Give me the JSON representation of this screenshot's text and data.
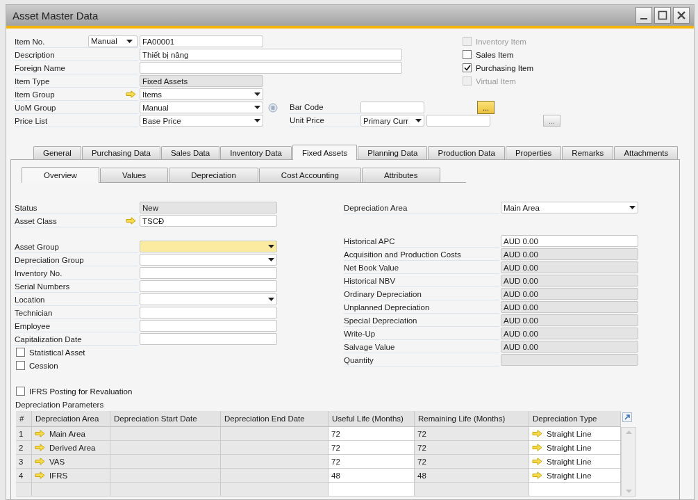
{
  "window": {
    "title": "Asset Master Data"
  },
  "header": {
    "rows": [
      {
        "label": "Item No.",
        "kind": "numbered",
        "series": "Manual",
        "value": "FA00001",
        "linked": false
      },
      {
        "label": "Description",
        "kind": "long-text",
        "value": "Thiết bị nâng",
        "linked": false
      },
      {
        "label": "Foreign Name",
        "kind": "long-text",
        "linked": false
      },
      {
        "label": "Item Type",
        "kind": "readonly",
        "value": "Fixed Assets",
        "linked": false
      },
      {
        "label": "Item Group",
        "kind": "dropdown",
        "value": "Items",
        "linked": true
      },
      {
        "label": "UoM Group",
        "kind": "dropdown-detail",
        "value": "Manual",
        "linked": false,
        "side": {
          "kind": "text-button",
          "label": "Bar Code",
          "button": {
            "label": "...",
            "highlighted": true
          }
        }
      },
      {
        "label": "Price List",
        "kind": "dropdown",
        "value": "Base Price",
        "linked": false,
        "side": {
          "kind": "currency-price",
          "label": "Unit Price",
          "currency": "Primary Curr",
          "button": {
            "label": "...",
            "highlighted": false
          }
        }
      }
    ],
    "checkboxes": [
      {
        "label": "Inventory Item",
        "checked": false,
        "disabled": true
      },
      {
        "label": "Sales Item",
        "checked": false,
        "disabled": false
      },
      {
        "label": "Purchasing Item",
        "checked": true,
        "disabled": false
      },
      {
        "label": "Virtual Item",
        "checked": false,
        "disabled": true
      }
    ]
  },
  "tabs": [
    {
      "label": "General",
      "selected": false
    },
    {
      "label": "Purchasing Data",
      "selected": false
    },
    {
      "label": "Sales Data",
      "selected": false
    },
    {
      "label": "Inventory Data",
      "selected": false
    },
    {
      "label": "Fixed Assets",
      "selected": true
    },
    {
      "label": "Planning Data",
      "selected": false
    },
    {
      "label": "Production Data",
      "selected": false
    },
    {
      "label": "Properties",
      "selected": false
    },
    {
      "label": "Remarks",
      "selected": false
    },
    {
      "label": "Attachments",
      "selected": false
    }
  ],
  "subtabs": [
    {
      "label": "Overview",
      "selected": true
    },
    {
      "label": "Values",
      "selected": false
    },
    {
      "label": "Depreciation",
      "selected": false
    },
    {
      "label": "Cost Accounting",
      "selected": false
    },
    {
      "label": "Attributes",
      "selected": false
    }
  ],
  "overview": {
    "identity_fields": [
      {
        "label": "Status",
        "kind": "readonly",
        "value": "New",
        "linked": false,
        "focused": false
      },
      {
        "label": "Asset Class",
        "kind": "text",
        "value": "TSCĐ",
        "linked": true,
        "focused": false
      }
    ],
    "assignment_fields": [
      {
        "label": "Asset Group",
        "kind": "dropdown",
        "linked": false,
        "focused": true
      },
      {
        "label": "Depreciation Group",
        "kind": "dropdown",
        "linked": false,
        "focused": false
      },
      {
        "label": "Inventory No.",
        "kind": "text",
        "linked": false,
        "focused": false
      },
      {
        "label": "Serial Numbers",
        "kind": "text",
        "linked": false,
        "focused": false
      },
      {
        "label": "Location",
        "kind": "dropdown",
        "linked": false,
        "focused": false
      },
      {
        "label": "Technician",
        "kind": "text",
        "linked": false,
        "focused": false
      },
      {
        "label": "Employee",
        "kind": "text",
        "linked": false,
        "focused": false
      },
      {
        "label": "Capitalization Date",
        "kind": "text",
        "linked": false,
        "focused": false
      }
    ],
    "flags": [
      {
        "label": "Statistical Asset",
        "checked": false
      },
      {
        "label": "Cession",
        "checked": false
      }
    ],
    "ifrs": {
      "label": "IFRS Posting for Revaluation",
      "checked": false
    },
    "depreciation_area": {
      "label": "Depreciation Area",
      "value": "Main Area"
    },
    "amounts": [
      {
        "label": "Historical APC",
        "value": "AUD 0.00",
        "readonly": false
      },
      {
        "label": "Acquisition and Production Costs",
        "value": "AUD 0.00",
        "readonly": true
      },
      {
        "label": "Net Book Value",
        "value": "AUD 0.00",
        "readonly": true
      },
      {
        "label": "Historical NBV",
        "value": "AUD 0.00",
        "readonly": true
      },
      {
        "label": "Ordinary Depreciation",
        "value": "AUD 0.00",
        "readonly": true
      },
      {
        "label": "Unplanned Depreciation",
        "value": "AUD 0.00",
        "readonly": true
      },
      {
        "label": "Special Depreciation",
        "value": "AUD 0.00",
        "readonly": true
      },
      {
        "label": "Write-Up",
        "value": "AUD 0.00",
        "readonly": true
      },
      {
        "label": "Salvage Value",
        "value": "AUD 0.00",
        "readonly": true
      },
      {
        "label": "Quantity",
        "readonly": true
      }
    ]
  },
  "parameters": {
    "title": "Depreciation Parameters",
    "columns": [
      "#",
      "Depreciation Area",
      "Depreciation Start Date",
      "Depreciation End Date",
      "Useful Life (Months)",
      "Remaining Life (Months)",
      "Depreciation Type"
    ],
    "rows": [
      {
        "number": "1",
        "area": "Main Area",
        "useful_life": "72",
        "remaining_life": "72",
        "type": "Straight Line"
      },
      {
        "number": "2",
        "area": "Derived Area",
        "useful_life": "72",
        "remaining_life": "72",
        "type": "Straight Line"
      },
      {
        "number": "3",
        "area": "VAS",
        "useful_life": "72",
        "remaining_life": "72",
        "type": "Straight Line"
      },
      {
        "number": "4",
        "area": "IFRS",
        "useful_life": "48",
        "remaining_life": "48",
        "type": "Straight Line"
      }
    ]
  }
}
